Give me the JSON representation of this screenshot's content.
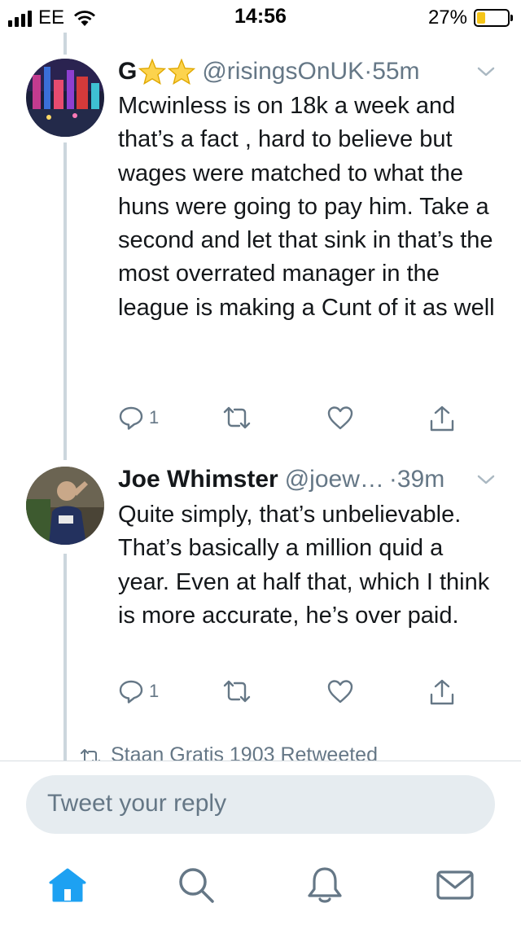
{
  "status_bar": {
    "carrier": "EE",
    "time": "14:56",
    "battery_percent": "27%",
    "battery_level": 0.27,
    "battery_color": "#f5c518"
  },
  "tweets": [
    {
      "display_name": "G",
      "name_emoji": [
        "star-icon",
        "star-icon"
      ],
      "handle": "@risingsOnUK",
      "dot": "·",
      "time": "55m",
      "text": "Mcwinless is on 18k a week and that’s a fact ,  hard to believe but wages were matched to what the huns were going to pay him. Take a second and let that sink in that’s the most overrated manager in the league is making a Cunt of it as well",
      "reply_count": "1"
    },
    {
      "display_name": "Joe Whimster",
      "handle": "@joew…",
      "dot": "·",
      "time": "39m",
      "text": "Quite simply, that’s unbelievable. That’s basically a million quid a year. Even at half that, which I think is more accurate, he’s over paid.",
      "reply_count": "1"
    }
  ],
  "retweet_note": "Staan Gratis 1903 Retweeted",
  "reply_bar": {
    "placeholder": "Tweet your reply"
  },
  "tab_bar": {
    "items": [
      "home-icon",
      "search-icon",
      "notifications-icon",
      "messages-icon"
    ],
    "active": "home-icon"
  },
  "colors": {
    "accent": "#1da1f2",
    "secondary_text": "#657786",
    "thread_line": "#ccd6dd"
  }
}
